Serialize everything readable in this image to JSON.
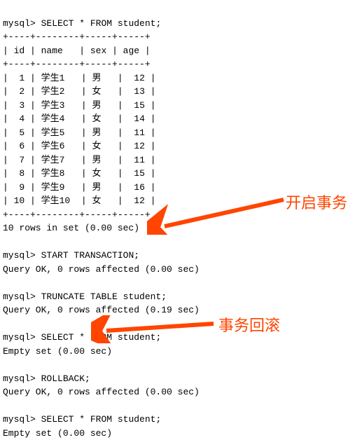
{
  "prompt": "mysql>",
  "queries": {
    "select1": "SELECT * FROM student;",
    "start_tx": "START TRANSACTION;",
    "truncate": "TRUNCATE TABLE student;",
    "select2": "SELECT * FROM student;",
    "rollback": "ROLLBACK;",
    "select3": "SELECT * FROM student;"
  },
  "table": {
    "border_top": "+------+--------+------+------+",
    "headers": [
      "id",
      "name",
      "sex",
      "age"
    ],
    "rows": [
      {
        "id": "1",
        "name": "学生1",
        "sex": "男",
        "age": "12"
      },
      {
        "id": "2",
        "name": "学生2",
        "sex": "女",
        "age": "13"
      },
      {
        "id": "3",
        "name": "学生3",
        "sex": "男",
        "age": "15"
      },
      {
        "id": "4",
        "name": "学生4",
        "sex": "女",
        "age": "14"
      },
      {
        "id": "5",
        "name": "学生5",
        "sex": "男",
        "age": "11"
      },
      {
        "id": "6",
        "name": "学生6",
        "sex": "女",
        "age": "12"
      },
      {
        "id": "7",
        "name": "学生7",
        "sex": "男",
        "age": "11"
      },
      {
        "id": "8",
        "name": "学生8",
        "sex": "女",
        "age": "15"
      },
      {
        "id": "9",
        "name": "学生9",
        "sex": "男",
        "age": "16"
      },
      {
        "id": "10",
        "name": "学生10",
        "sex": "女",
        "age": "12"
      }
    ]
  },
  "results": {
    "rows_in_set": "10 rows in set (0.00 sec)",
    "query_ok_000": "Query OK, 0 rows affected (0.00 sec)",
    "query_ok_019": "Query OK, 0 rows affected (0.19 sec)",
    "empty_set": "Empty set (0.00 sec)"
  },
  "annotations": {
    "start_tx": "开启事务",
    "rollback": "事务回滚"
  },
  "colors": {
    "arrow": "#ff4500",
    "text": "#000000"
  }
}
